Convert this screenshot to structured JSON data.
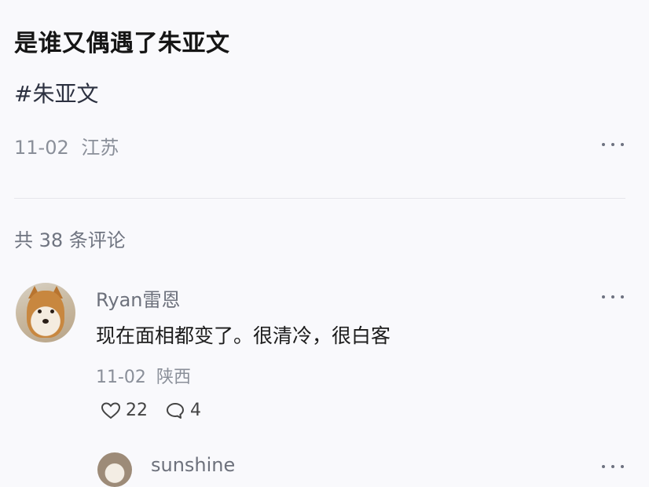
{
  "post": {
    "title": "是谁又偶遇了朱亚文",
    "hashtag": "#朱亚文",
    "date": "11-02",
    "location": "江苏"
  },
  "comments_header": {
    "count_text": "共 38 条评论"
  },
  "comments": [
    {
      "username": "Ryan雷恩",
      "text": "现在面相都变了。很清冷，很白客",
      "date": "11-02",
      "location": "陕西",
      "likes": "22",
      "replies": "4"
    }
  ],
  "reply_preview": {
    "username": "sunshine"
  },
  "icons": {
    "more": "more-dots-icon",
    "like": "heart-icon",
    "reply": "speech-bubble-icon"
  }
}
